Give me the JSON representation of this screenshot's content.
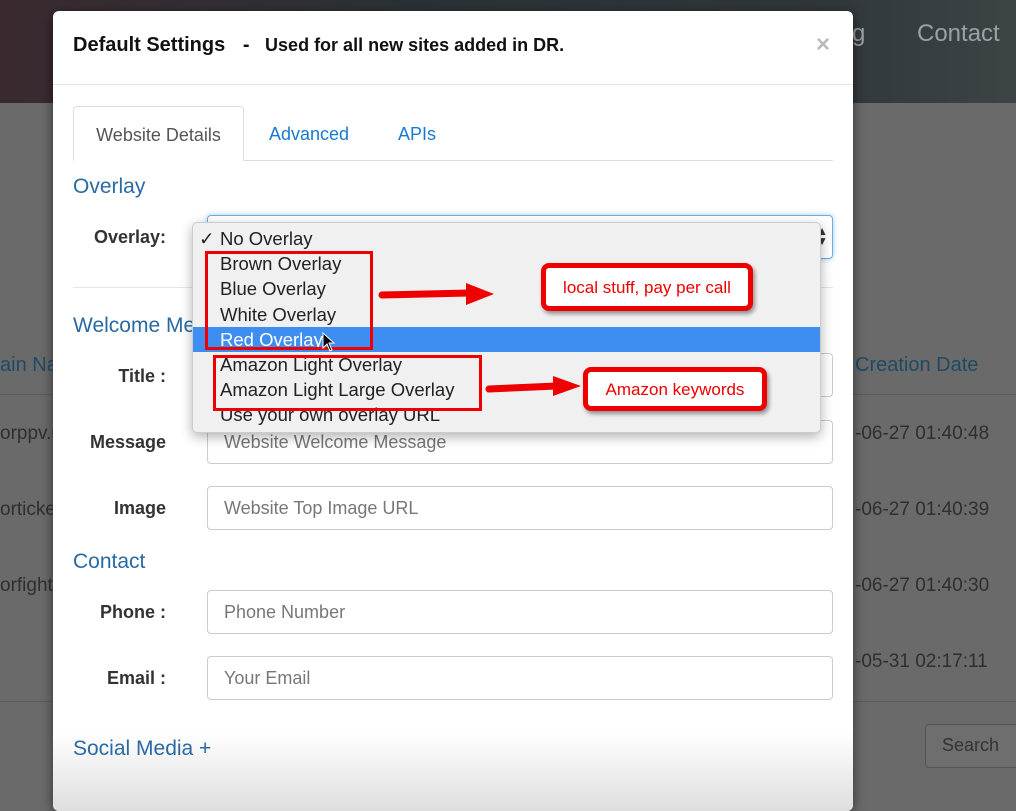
{
  "background": {
    "nav": {
      "partial_item": "g",
      "contact": "Contact"
    },
    "table": {
      "col_domain_header": "ain Na",
      "col_date_header": "Creation Date",
      "rows": [
        {
          "domain": "orppv.u",
          "date": "-06-27 01:40:48"
        },
        {
          "domain": "orticke",
          "date": "-06-27 01:40:39"
        },
        {
          "domain": "orfight.",
          "date": "-06-27 01:40:30"
        },
        {
          "domain": "",
          "date": "-05-31 02:17:11"
        }
      ]
    },
    "search_button": "Search"
  },
  "modal": {
    "title": "Default Settings",
    "separator": "-",
    "subtitle": "Used for all new sites added in DR.",
    "close": "×",
    "tabs": [
      {
        "label": "Website Details",
        "active": true
      },
      {
        "label": "Advanced",
        "active": false
      },
      {
        "label": "APIs",
        "active": false
      }
    ],
    "overlay_section": "Overlay",
    "overlay_label": "Overlay:",
    "overlay_options": [
      {
        "label": "No Overlay",
        "checked": true
      },
      {
        "label": "Brown Overlay"
      },
      {
        "label": "Blue Overlay"
      },
      {
        "label": "White Overlay"
      },
      {
        "label": "Red Overlay",
        "highlighted": true
      },
      {
        "label": "Amazon Light Overlay"
      },
      {
        "label": "Amazon Light Large Overlay"
      },
      {
        "label": "Use your own overlay URL"
      }
    ],
    "check_mark": "✓",
    "welcome_section": "Welcome Me",
    "title_label": "Title :",
    "message_label": "Message",
    "message_placeholder": "Website Welcome Message",
    "image_label": "Image",
    "image_placeholder": "Website Top Image URL",
    "contact_section": "Contact",
    "phone_label": "Phone :",
    "phone_placeholder": "Phone Number",
    "email_label": "Email :",
    "email_placeholder": "Your Email",
    "social_section": "Social Media +"
  },
  "annotations": {
    "callout_local": "local stuff, pay per call",
    "callout_amazon": "Amazon keywords",
    "color": "#e00000"
  },
  "colors": {
    "accent": "#2a6aa3",
    "link": "#1a7ad0",
    "highlight": "#3d8ef0"
  }
}
